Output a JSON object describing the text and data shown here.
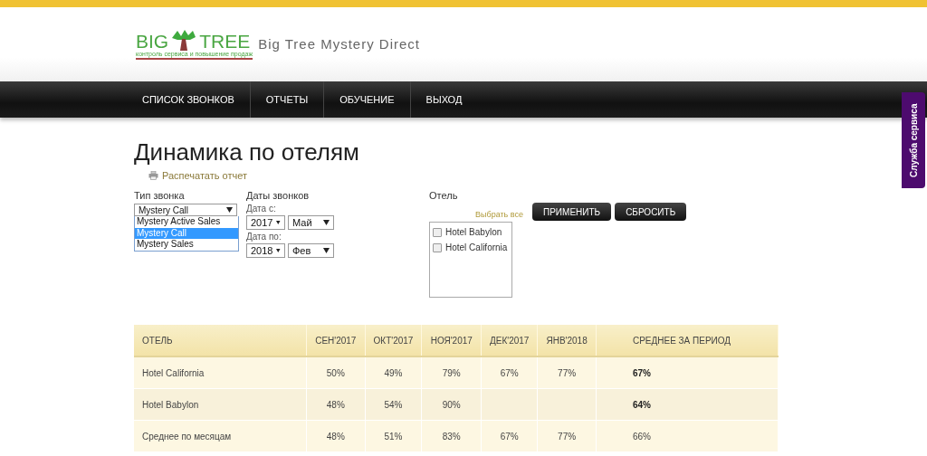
{
  "header": {
    "logo_left": "BIG",
    "logo_right": "TREE",
    "logo_tagline": "контроль сервиса и повышение продаж",
    "site_title": "Big Tree Mystery Direct"
  },
  "nav": {
    "items": [
      "СПИСОК ЗВОНКОВ",
      "ОТЧЕТЫ",
      "ОБУЧЕНИЕ",
      "ВЫХОД"
    ]
  },
  "side_tab": {
    "label": "Служба сервиса"
  },
  "page_title": "Динамика по отелям",
  "print_link": "Распечатать отчет",
  "filters": {
    "call_type": {
      "label": "Тип звонка",
      "value": "Mystery Call",
      "options": [
        {
          "label": "Mystery Active Sales",
          "selected": false
        },
        {
          "label": "Mystery Call",
          "selected": true
        },
        {
          "label": "Mystery Sales",
          "selected": false
        }
      ]
    },
    "dates": {
      "label": "Даты звонков",
      "from_label": "Дата с:",
      "from_year": "2017",
      "from_month": "Май",
      "to_label": "Дата по:",
      "to_year": "2018",
      "to_month": "Фев"
    },
    "hotel": {
      "label": "Отель",
      "select_all": "Выбрать все",
      "items": [
        {
          "label": "Hotel Babylon",
          "checked": false
        },
        {
          "label": "Hotel California",
          "checked": false
        }
      ]
    },
    "buttons": [
      "ПРИМЕНИТЬ",
      "СБРОСИТЬ"
    ]
  },
  "table": {
    "columns": [
      "ОТЕЛЬ",
      "СЕН'2017",
      "ОКТ'2017",
      "НОЯ'2017",
      "ДЕК'2017",
      "ЯНВ'2018",
      "СРЕДНЕЕ ЗА ПЕРИОД"
    ],
    "rows": [
      {
        "kind": "hotel",
        "cells": [
          "Hotel California",
          "50%",
          "49%",
          "79%",
          "67%",
          "77%",
          "67%"
        ]
      },
      {
        "kind": "hotel",
        "cells": [
          "Hotel Babylon",
          "48%",
          "54%",
          "90%",
          "",
          "",
          "64%"
        ]
      },
      {
        "kind": "total",
        "cells": [
          "Среднее по месяцам",
          "48%",
          "51%",
          "83%",
          "67%",
          "77%",
          "66%"
        ]
      }
    ]
  }
}
